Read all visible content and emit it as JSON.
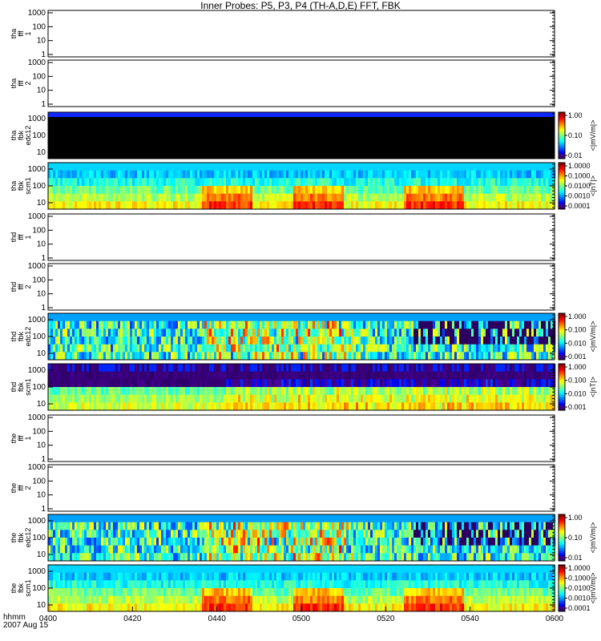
{
  "title": "Inner Probes: P5, P3, P4 (TH-A,D,E) FFT, FBK",
  "footer": {
    "time_label": "hhmm",
    "date_label": "2007 Aug 15"
  },
  "colors": {
    "axis": "#000000",
    "background": "#ffffff"
  },
  "x_axis": {
    "ticks": [
      "0400",
      "0420",
      "0440",
      "0500",
      "0520",
      "0540",
      "0600"
    ]
  },
  "chart_data": [
    {
      "type": "heatmap",
      "ylabel": [
        "tha",
        "fff",
        "1"
      ],
      "yticks": [
        "1000",
        "100",
        "10",
        "1"
      ],
      "data": "empty",
      "colorbar": null
    },
    {
      "type": "heatmap",
      "ylabel": [
        "tha",
        "fff",
        "2"
      ],
      "yticks": [
        "1000",
        "100",
        "10",
        "1"
      ],
      "data": "empty",
      "colorbar": null
    },
    {
      "type": "heatmap",
      "ylabel": [
        "tha",
        "fbk",
        "edc12"
      ],
      "yticks": [
        "1000",
        "100",
        "10"
      ],
      "data": "black",
      "colorbar": {
        "ticks": [
          "1.00",
          "0.10",
          "0.01"
        ],
        "unit": "<|mV/m|>"
      }
    },
    {
      "type": "heatmap",
      "ylabel": [
        "tha",
        "fbk",
        "scm1"
      ],
      "yticks": [
        "1000",
        "100",
        "10"
      ],
      "data": "spectrum-low",
      "colorbar": {
        "ticks": [
          "1.0000",
          "0.1000",
          "0.0100",
          "0.0010",
          "0.0001"
        ],
        "unit": "<|nT|>"
      }
    },
    {
      "type": "heatmap",
      "ylabel": [
        "thd",
        "fff",
        "1"
      ],
      "yticks": [
        "1000",
        "100",
        "10",
        "1"
      ],
      "data": "empty",
      "colorbar": null
    },
    {
      "type": "heatmap",
      "ylabel": [
        "thd",
        "fff",
        "2"
      ],
      "yticks": [
        "1000",
        "100",
        "10",
        "1"
      ],
      "data": "empty",
      "colorbar": null
    },
    {
      "type": "heatmap",
      "ylabel": [
        "thd",
        "fbk",
        "edc12"
      ],
      "yticks": [
        "1000",
        "100",
        "10"
      ],
      "data": "spectrum-mixed",
      "colorbar": {
        "ticks": [
          "1.000",
          "0.100",
          "0.010",
          "0.001"
        ],
        "unit": "<|mV/m|>"
      }
    },
    {
      "type": "heatmap",
      "ylabel": [
        "thd",
        "fbk",
        "scm1"
      ],
      "yticks": [
        "1000",
        "100",
        "10"
      ],
      "data": "spectrum-purple",
      "colorbar": {
        "ticks": [
          "1.000",
          "0.100",
          "0.010",
          "0.001"
        ],
        "unit": "<|nT|>"
      }
    },
    {
      "type": "heatmap",
      "ylabel": [
        "the",
        "fff",
        "1"
      ],
      "yticks": [
        "1000",
        "100",
        "10",
        "1"
      ],
      "data": "empty",
      "colorbar": null
    },
    {
      "type": "heatmap",
      "ylabel": [
        "the",
        "fff",
        "2"
      ],
      "yticks": [
        "1000",
        "100",
        "10",
        "1"
      ],
      "data": "empty",
      "colorbar": null
    },
    {
      "type": "heatmap",
      "ylabel": [
        "the",
        "fbk",
        "edc12"
      ],
      "yticks": [
        "1000",
        "100",
        "10"
      ],
      "data": "spectrum-mixed",
      "colorbar": {
        "ticks": [
          "1.00",
          "0.10",
          "0.01"
        ],
        "unit": "<|mV/m|>"
      }
    },
    {
      "type": "heatmap",
      "ylabel": [
        "the",
        "fbk",
        "scm1"
      ],
      "yticks": [
        "1000",
        "100",
        "10"
      ],
      "data": "spectrum-low",
      "colorbar": {
        "ticks": [
          "1.0000",
          "0.1000",
          "0.0100",
          "0.0010",
          "0.0001"
        ],
        "unit": "<|mV/m|>"
      }
    }
  ]
}
